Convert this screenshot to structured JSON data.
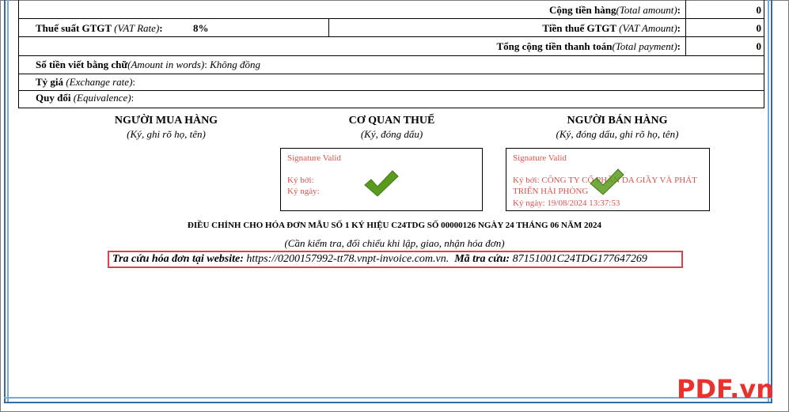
{
  "totals": {
    "total_amount": {
      "label": "Cộng tiền hàng",
      "label_en": "(Total amount)",
      "colon": ":",
      "value": "0"
    },
    "vat_rate": {
      "label": "Thuế suất GTGT",
      "label_en": "(VAT Rate)",
      "colon": ":",
      "value": "8%"
    },
    "vat_amount": {
      "label": "Tiền thuế GTGT",
      "label_en": "(VAT Amount)",
      "colon": ":",
      "value": "0"
    },
    "total_payment": {
      "label": "Tổng cộng tiền thanh toán",
      "label_en": "(Total payment)",
      "colon": ":",
      "value": "0"
    }
  },
  "words": {
    "label": "Số tiền viết bằng chữ",
    "label_en": "(Amount in words)",
    "colon": ":",
    "value": "Không đồng"
  },
  "exchange_rate": {
    "label": "Tỷ giá",
    "label_en": "(Exchange rate)",
    "colon": ":"
  },
  "equivalence": {
    "label": "Quy đổi",
    "label_en": "(Equivalence)",
    "colon": ":"
  },
  "signatures": {
    "buyer": {
      "title": "NGƯỜI MUA HÀNG",
      "sub": "(Ký, ghi rõ họ, tên)"
    },
    "tax": {
      "title": "CƠ QUAN THUẾ",
      "sub": "(Ký, đóng dấu)",
      "valid": "Signature Valid",
      "signer": "Ký bởi:",
      "date": "Ký ngày:"
    },
    "seller": {
      "title": "NGƯỜI BÁN HÀNG",
      "sub": "(Ký, đóng dấu, ghi rõ họ, tên)",
      "valid": "Signature Valid",
      "signer": "Ký bởi: CÔNG TY CỔ PHẦN DA GIẦY VÀ PHÁT TRIỂN HẢI PHÒNG",
      "date": "Ký ngày: 19/08/2024 13:37:53"
    }
  },
  "adjustment": "ĐIỀU CHỈNH CHO HÓA ĐƠN MẪU SỐ 1 KÝ HIỆU C24TDG SỐ 00000126 NGÀY 24 THÁNG 06 NĂM 2024",
  "note": "(Cần kiểm tra, đối chiếu khi lập, giao, nhận hóa đơn)",
  "lookup": {
    "website_label": "Tra cứu hóa đơn tại website:",
    "website": "https://0200157992-tt78.vnpt-invoice.com.vn.",
    "code_label": "Mã tra cứu:",
    "code": "87151001C24TDG177647269"
  },
  "brand": "PDF.vn",
  "colors": {
    "check": "#5a9a1f",
    "signature_text": "#d9534f",
    "highlight": "#e0404a",
    "brand": "#e8322e",
    "border_blue": "#2f6ea5"
  },
  "icons": [
    "check-icon"
  ]
}
